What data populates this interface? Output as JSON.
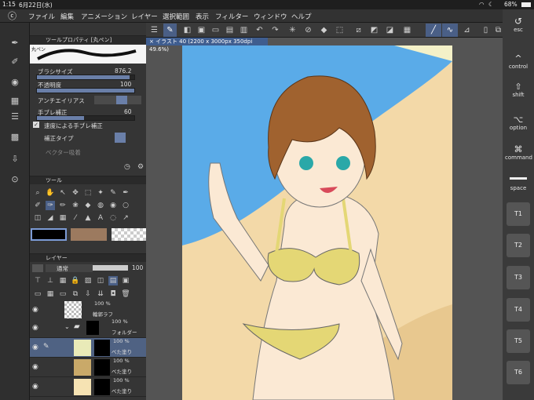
{
  "status": {
    "time": "1:15",
    "date": "6月22日(水)",
    "battery": "68%"
  },
  "menu": [
    "ファイル",
    "編集",
    "アニメーション",
    "レイヤー",
    "選択範囲",
    "表示",
    "フィルター",
    "ウィンドウ",
    "ヘルプ"
  ],
  "doc_tab": "× イラスト 40 (2200 x 3000px 350dpi 49.6%)",
  "tool_property": {
    "header": "ツールプロパティ [丸ペン]",
    "brush_name": "丸ペン",
    "brush_size_label": "ブラシサイズ",
    "brush_size": "876.2",
    "opacity_label": "不透明度",
    "opacity": "100",
    "antialias_label": "アンチエイリアス",
    "stabilization_label": "手ブレ補正",
    "stabilization": "60",
    "speed_label": "速度による手ブレ補正",
    "correction_label": "補正タイプ",
    "vector_label": "ベクター吸着"
  },
  "tool_panel": {
    "header": "ツール"
  },
  "layer_panel": {
    "header": "レイヤー",
    "blend": "通常",
    "opacity": "100",
    "layers": [
      {
        "pct": "100 %",
        "name": "輪郭ラフ"
      },
      {
        "pct": "100 %",
        "name": "フォルダー"
      },
      {
        "pct": "100 %",
        "name": "べた塗り"
      },
      {
        "pct": "100 %",
        "name": "べた塗り"
      },
      {
        "pct": "100 %",
        "name": "べた塗り"
      }
    ]
  },
  "keys": {
    "esc": "esc",
    "control": "control",
    "shift": "shift",
    "option": "option",
    "command": "command",
    "space": "space",
    "fkeys": [
      "T1",
      "T2",
      "T3",
      "T4",
      "T5",
      "T6"
    ]
  },
  "colors": {
    "accent": "#4a5f86",
    "sky": "#5aabe8",
    "sand": "#f3d9a8",
    "skin": "#fbe9d4",
    "hair": "#a0622f",
    "bikini": "#e4d775"
  }
}
